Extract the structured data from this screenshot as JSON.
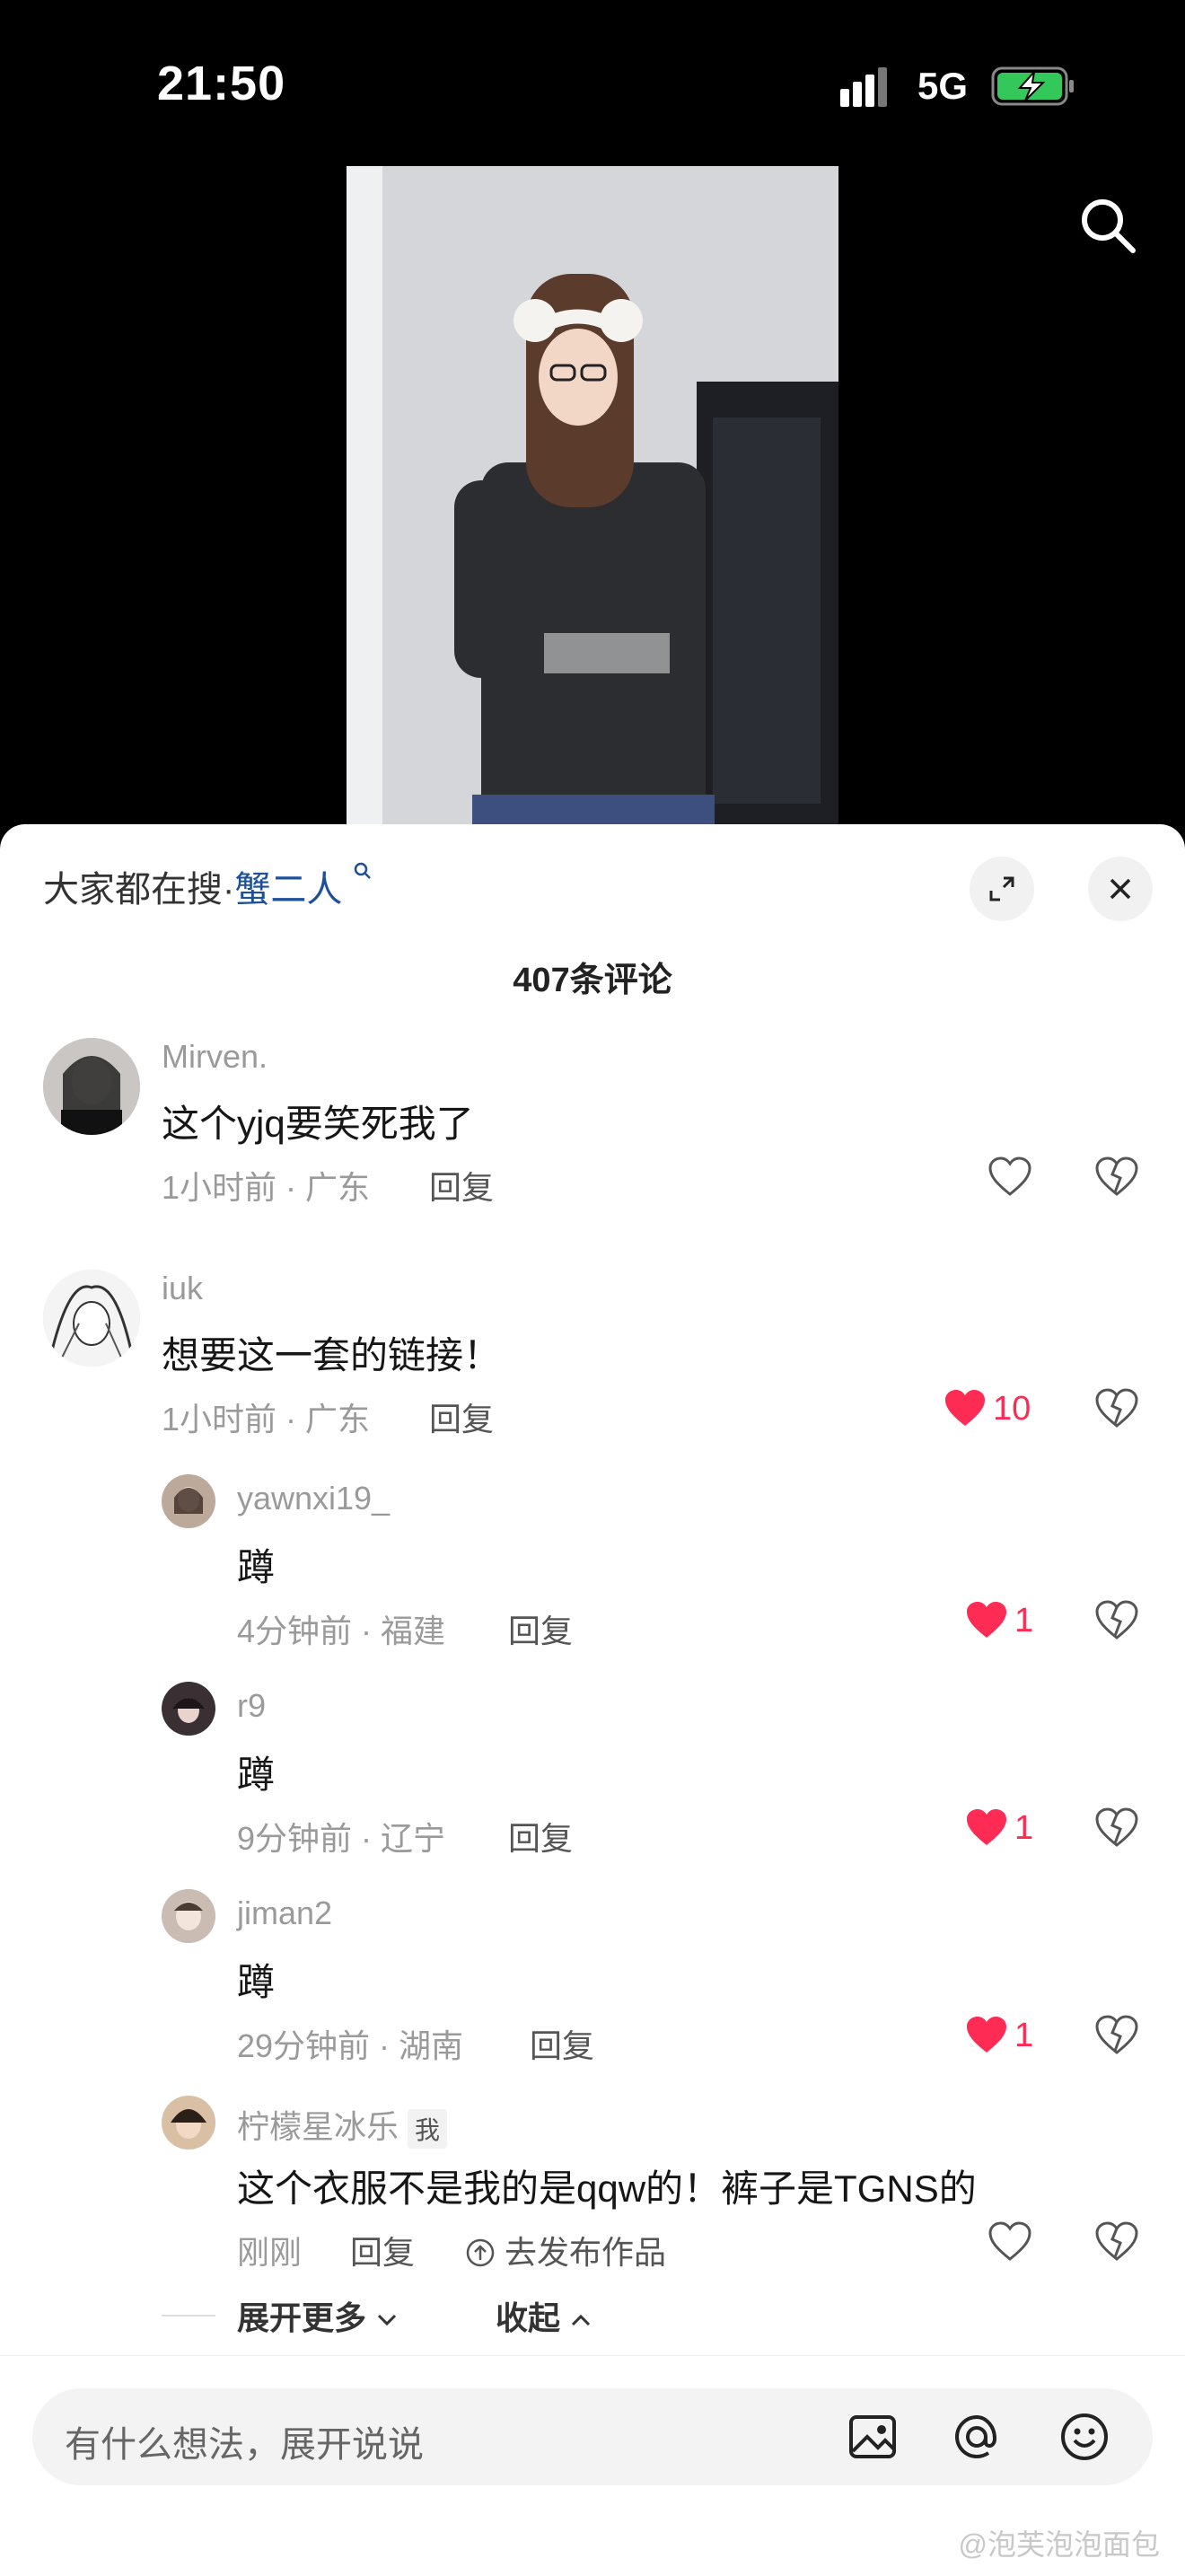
{
  "status": {
    "time": "21:50",
    "network": "5G"
  },
  "trending": {
    "prefix": "大家都在搜·",
    "keyword": "蟹二人"
  },
  "comment_count": "407条评论",
  "comments": [
    {
      "user": "Mirven.",
      "text": "这个yjq要笑死我了",
      "meta": "1小时前 · 广东",
      "reply": "回复",
      "likes": ""
    },
    {
      "user": "iuk",
      "text": "想要这一套的链接！",
      "meta": "1小时前 · 广东",
      "reply": "回复",
      "likes": "10"
    },
    {
      "user": "yawnxi19_",
      "text": "蹲",
      "meta": "4分钟前 · 福建",
      "reply": "回复",
      "likes": "1"
    },
    {
      "user": "r9",
      "text": "蹲",
      "meta": "9分钟前 · 辽宁",
      "reply": "回复",
      "likes": "1"
    },
    {
      "user": "jiman2",
      "text": "蹲",
      "meta": "29分钟前 · 湖南",
      "reply": "回复",
      "likes": "1"
    },
    {
      "user": "柠檬星冰乐",
      "tag": "我",
      "text": "这个衣服不是我的是qqw的！裤子是TGNS的",
      "meta": "刚刚",
      "reply": "回复",
      "publish": "去发布作品",
      "likes": ""
    }
  ],
  "expand": {
    "more": "展开更多",
    "collapse": "收起"
  },
  "input": {
    "placeholder": "有什么想法，展开说说"
  },
  "watermark": "@泡芙泡泡面包",
  "colors": {
    "accent": "#fe2c55",
    "link": "#1d4f9a"
  }
}
